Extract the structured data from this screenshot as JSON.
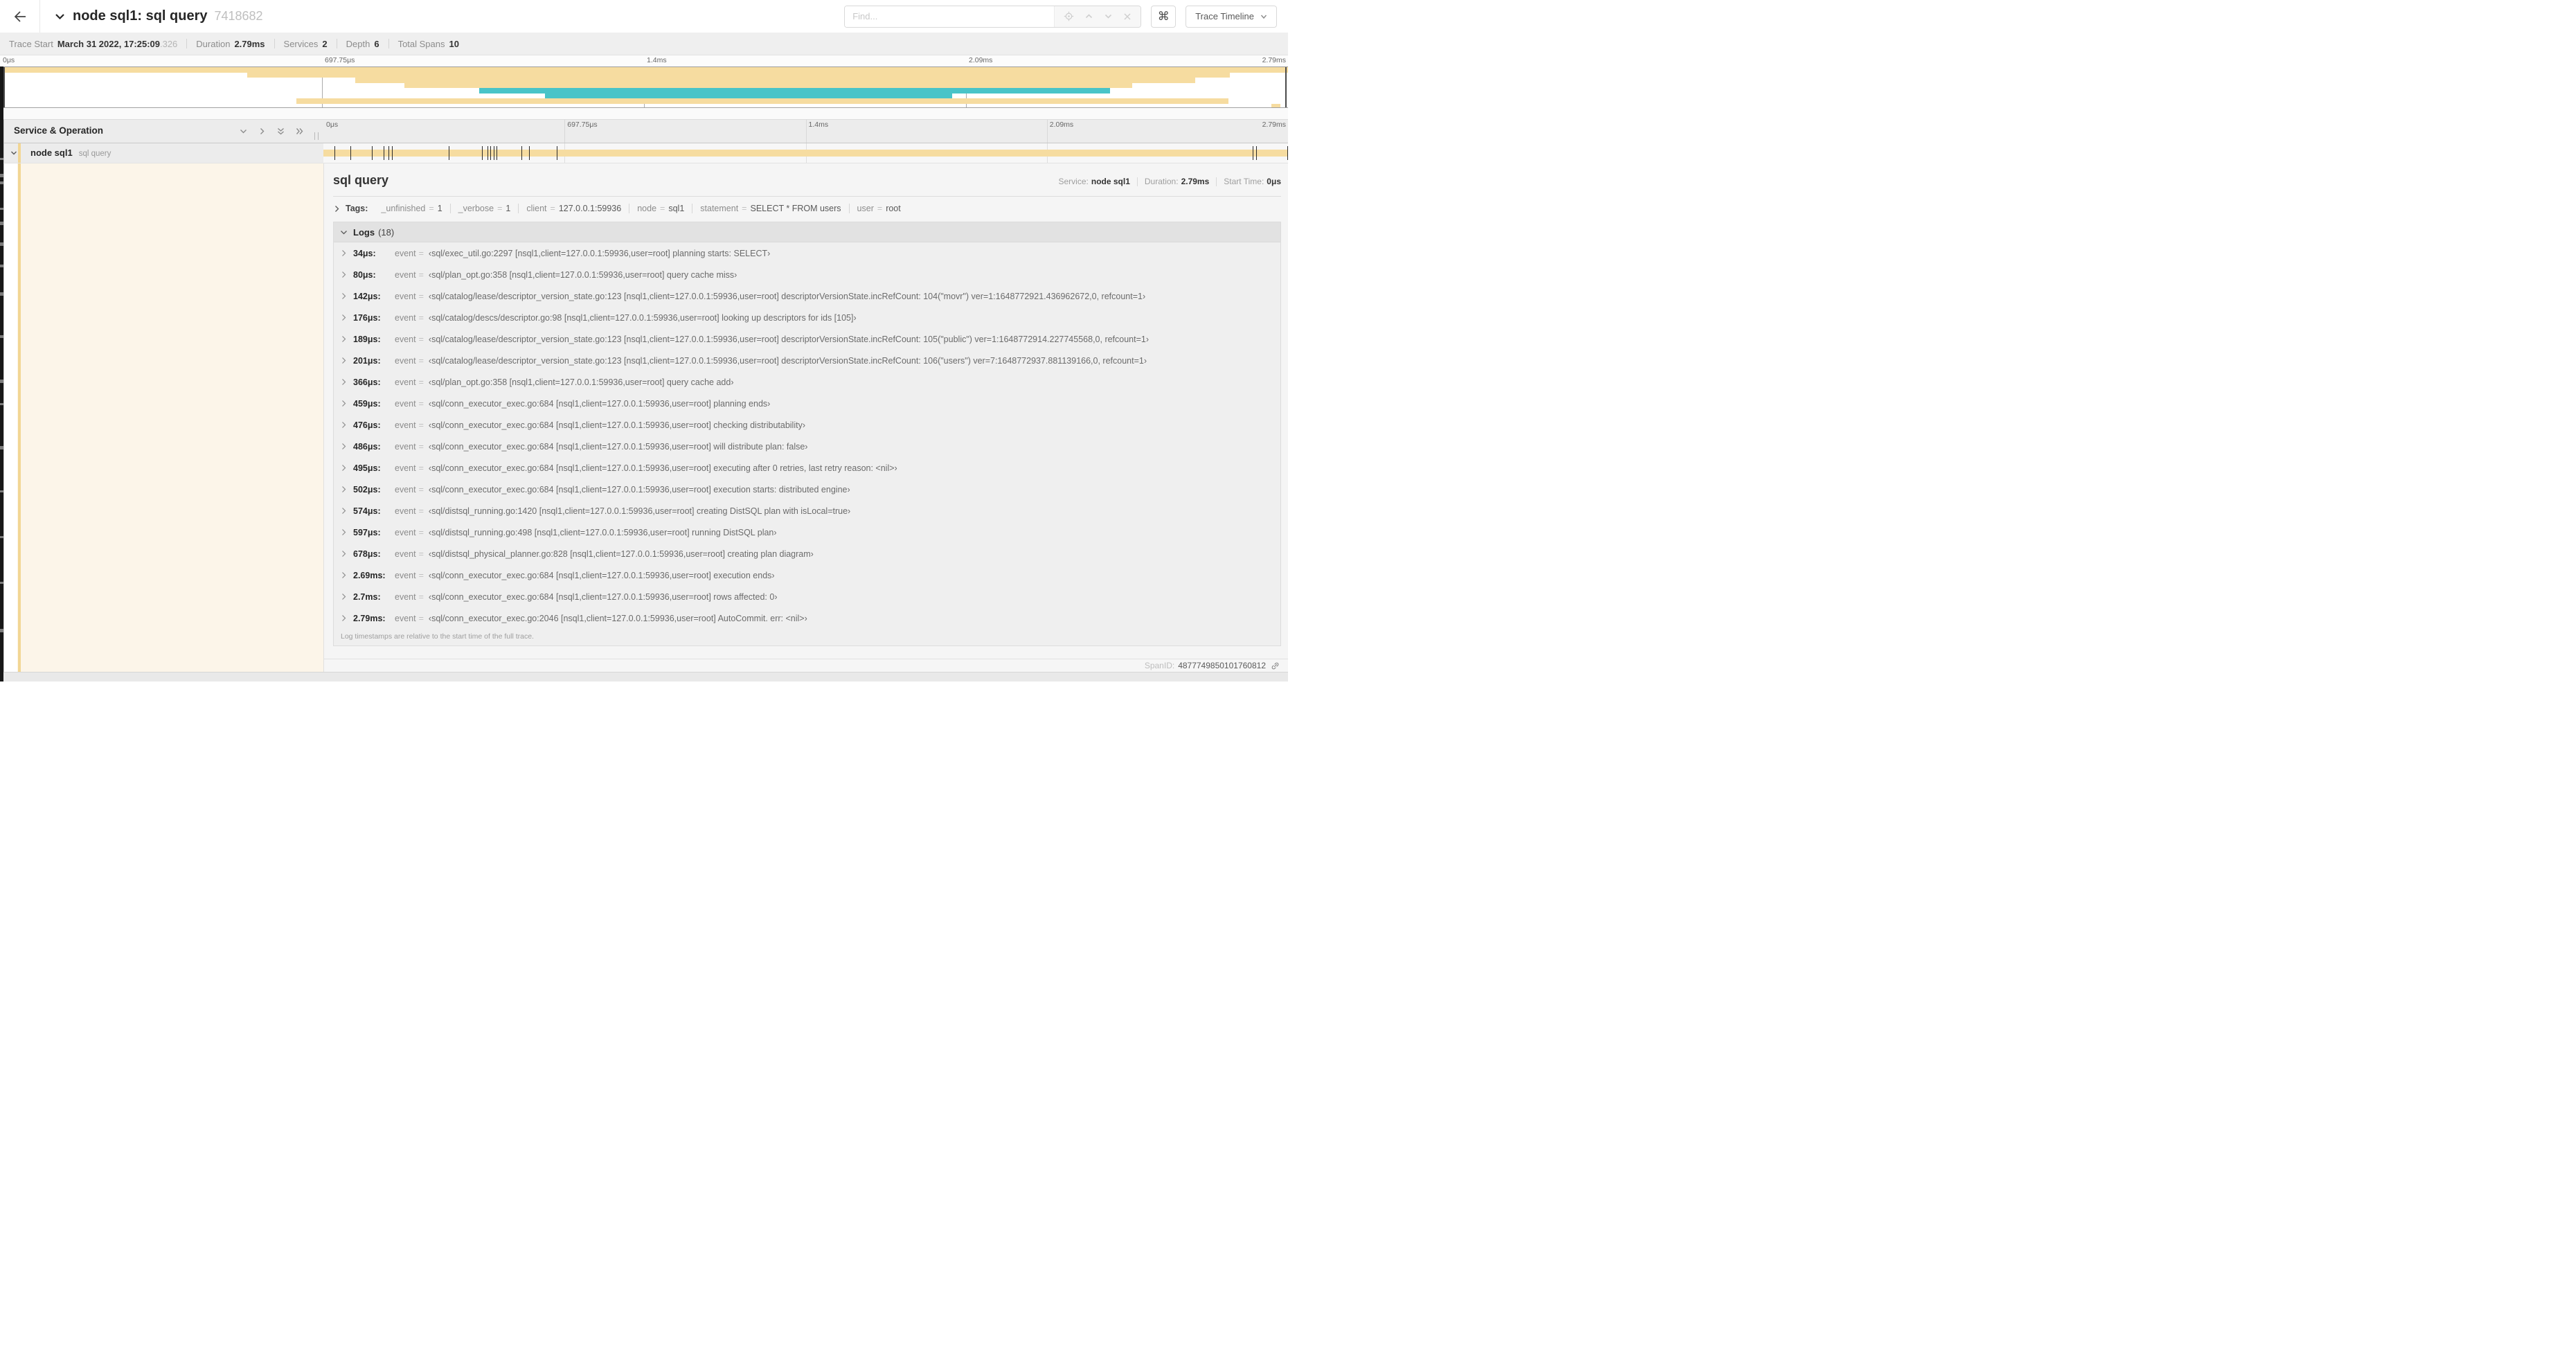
{
  "colors": {
    "span_tan": "#f6dca0",
    "span_teal": "#49c4c8",
    "stripe_tan": "#f2d694",
    "cream_tint": "#fcf5e9"
  },
  "header": {
    "title": "node sql1: sql query",
    "trace_id": "7418682",
    "find_placeholder": "Find...",
    "shortcut_glyph": "⌘",
    "view_selector": "Trace Timeline"
  },
  "stats": {
    "trace_start_label": "Trace Start",
    "trace_start_value": "March 31 2022, 17:25:09",
    "trace_start_frac": ".326",
    "duration_label": "Duration",
    "duration_value": "2.79ms",
    "services_label": "Services",
    "services_value": "2",
    "depth_label": "Depth",
    "depth_value": "6",
    "total_spans_label": "Total Spans",
    "total_spans_value": "10"
  },
  "timeline": {
    "ruler": [
      {
        "label": "0μs",
        "pct": 0
      },
      {
        "label": "697.75μs",
        "pct": 25
      },
      {
        "label": "1.4ms",
        "pct": 50
      },
      {
        "label": "2.09ms",
        "pct": 75
      },
      {
        "label": "2.79ms",
        "pct": 100
      }
    ],
    "minimap_spans": [
      {
        "start": 0,
        "end": 100,
        "color": "tan"
      },
      {
        "start": 19.2,
        "end": 95.5,
        "color": "tan"
      },
      {
        "start": 27.6,
        "end": 92.8,
        "color": "tan"
      },
      {
        "start": 31.4,
        "end": 87.9,
        "color": "tan"
      },
      {
        "start": 37.2,
        "end": 86.2,
        "color": "teal"
      },
      {
        "start": 42.3,
        "end": 73.9,
        "color": "teal"
      },
      {
        "start": 23.0,
        "end": 95.4,
        "color": "tan"
      },
      {
        "start": 98.7,
        "end": 99.4,
        "color": "tan"
      }
    ]
  },
  "span_table": {
    "header_label": "Service & Operation",
    "row": {
      "service": "node sql1",
      "operation": "sql query"
    }
  },
  "detail": {
    "operation": "sql query",
    "service_label": "Service:",
    "service": "node sql1",
    "duration_label": "Duration:",
    "duration": "2.79ms",
    "start_label": "Start Time:",
    "start": "0μs",
    "tags_label": "Tags:",
    "tags": [
      {
        "key": "_unfinished",
        "value": "1"
      },
      {
        "key": "_verbose",
        "value": "1"
      },
      {
        "key": "client",
        "value": "127.0.0.1:59936"
      },
      {
        "key": "node",
        "value": "sql1"
      },
      {
        "key": "statement",
        "value": "SELECT * FROM users"
      },
      {
        "key": "user",
        "value": "root"
      }
    ],
    "logs_label": "Logs",
    "logs_count": "(18)",
    "log_field_label": "event",
    "logs": [
      {
        "time": "34μs",
        "pct": 1.2,
        "value": "‹sql/exec_util.go:2297 [nsql1,client=127.0.0.1:59936,user=root] planning starts: SELECT›"
      },
      {
        "time": "80μs",
        "pct": 2.9,
        "value": "‹sql/plan_opt.go:358 [nsql1,client=127.0.0.1:59936,user=root] query cache miss›"
      },
      {
        "time": "142μs",
        "pct": 5.1,
        "value": "‹sql/catalog/lease/descriptor_version_state.go:123 [nsql1,client=127.0.0.1:59936,user=root] descriptorVersionState.incRefCount: 104(\"movr\") ver=1:1648772921.436962672,0, refcount=1›"
      },
      {
        "time": "176μs",
        "pct": 6.3,
        "value": "‹sql/catalog/descs/descriptor.go:98 [nsql1,client=127.0.0.1:59936,user=root] looking up descriptors for ids [105]›"
      },
      {
        "time": "189μs",
        "pct": 6.8,
        "value": "‹sql/catalog/lease/descriptor_version_state.go:123 [nsql1,client=127.0.0.1:59936,user=root] descriptorVersionState.incRefCount: 105(\"public\") ver=1:1648772914.227745568,0, refcount=1›"
      },
      {
        "time": "201μs",
        "pct": 7.2,
        "value": "‹sql/catalog/lease/descriptor_version_state.go:123 [nsql1,client=127.0.0.1:59936,user=root] descriptorVersionState.incRefCount: 106(\"users\") ver=7:1648772937.881139166,0, refcount=1›"
      },
      {
        "time": "366μs",
        "pct": 13.1,
        "value": "‹sql/plan_opt.go:358 [nsql1,client=127.0.0.1:59936,user=root] query cache add›"
      },
      {
        "time": "459μs",
        "pct": 16.5,
        "value": "‹sql/conn_executor_exec.go:684 [nsql1,client=127.0.0.1:59936,user=root] planning ends›"
      },
      {
        "time": "476μs",
        "pct": 17.1,
        "value": "‹sql/conn_executor_exec.go:684 [nsql1,client=127.0.0.1:59936,user=root] checking distributability›"
      },
      {
        "time": "486μs",
        "pct": 17.4,
        "value": "‹sql/conn_executor_exec.go:684 [nsql1,client=127.0.0.1:59936,user=root] will distribute plan: false›"
      },
      {
        "time": "495μs",
        "pct": 17.7,
        "value": "‹sql/conn_executor_exec.go:684 [nsql1,client=127.0.0.1:59936,user=root] executing after 0 retries, last retry reason: <nil>›"
      },
      {
        "time": "502μs",
        "pct": 18.0,
        "value": "‹sql/conn_executor_exec.go:684 [nsql1,client=127.0.0.1:59936,user=root] execution starts: distributed engine›"
      },
      {
        "time": "574μs",
        "pct": 20.6,
        "value": "‹sql/distsql_running.go:1420 [nsql1,client=127.0.0.1:59936,user=root] creating DistSQL plan with isLocal=true›"
      },
      {
        "time": "597μs",
        "pct": 21.4,
        "value": "‹sql/distsql_running.go:498 [nsql1,client=127.0.0.1:59936,user=root] running DistSQL plan›"
      },
      {
        "time": "678μs",
        "pct": 24.3,
        "value": "‹sql/distsql_physical_planner.go:828 [nsql1,client=127.0.0.1:59936,user=root] creating plan diagram›"
      },
      {
        "time": "2.69ms",
        "pct": 96.4,
        "value": "‹sql/conn_executor_exec.go:684 [nsql1,client=127.0.0.1:59936,user=root] execution ends›"
      },
      {
        "time": "2.7ms",
        "pct": 96.8,
        "value": "‹sql/conn_executor_exec.go:684 [nsql1,client=127.0.0.1:59936,user=root] rows affected: 0›"
      },
      {
        "time": "2.79ms",
        "pct": 100,
        "value": "‹sql/conn_executor_exec.go:2046 [nsql1,client=127.0.0.1:59936,user=root] AutoCommit. err: <nil>›"
      }
    ],
    "note": "Log timestamps are relative to the start time of the full trace.",
    "span_id_label": "SpanID:",
    "span_id": "4877749850101760812"
  }
}
